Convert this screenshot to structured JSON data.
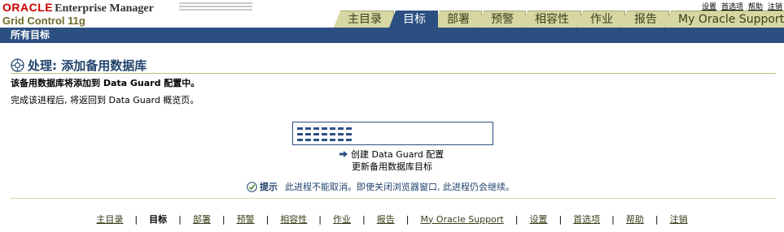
{
  "brand": {
    "oracle": "ORACLE",
    "product": "Enterprise Manager",
    "subtitle": "Grid Control 11g"
  },
  "global_links": [
    "设置",
    "首选项",
    "帮助",
    "注销"
  ],
  "tabs": [
    {
      "label": "主目录",
      "active": false
    },
    {
      "label": "目标",
      "active": true
    },
    {
      "label": "部署",
      "active": false
    },
    {
      "label": "预警",
      "active": false
    },
    {
      "label": "相容性",
      "active": false
    },
    {
      "label": "作业",
      "active": false
    },
    {
      "label": "报告",
      "active": false
    },
    {
      "label": "My Oracle Support",
      "active": false
    }
  ],
  "subnav": {
    "label": "所有目标"
  },
  "main": {
    "title": "处理: 添加备用数据库",
    "heading": "该备用数据库将添加到 Data Guard 配置中。",
    "subtext": "完成该进程后, 将返回到 Data Guard 概览页。",
    "steps": {
      "current": "创建 Data Guard 配置",
      "next": "更新备用数据库目标"
    },
    "tip": {
      "label": "提示",
      "text": "此进程不能取消。即使关闭浏览器窗口, 此进程仍会继续。"
    }
  },
  "footer": {
    "links": [
      "主目录",
      "目标",
      "部署",
      "预警",
      "相容性",
      "作业",
      "报告",
      "My Oracle Support",
      "设置",
      "首选项",
      "帮助",
      "注销"
    ],
    "current_index": 1
  },
  "colors": {
    "nav_blue": "#2c4f82",
    "tab_khaki": "#d7d7a4",
    "brand_red": "#cc0000"
  }
}
